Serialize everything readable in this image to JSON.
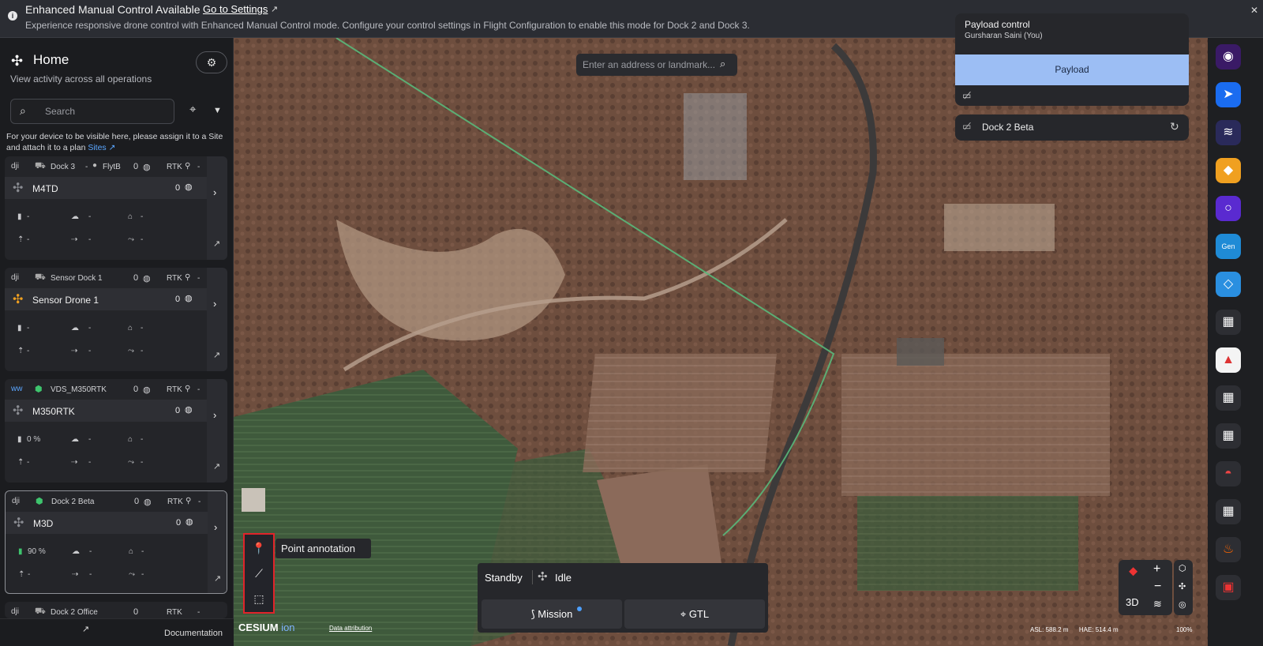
{
  "banner": {
    "title": "Enhanced Manual Control Available",
    "link": "Go to Settings",
    "body": "Experience responsive drone control with Enhanced Manual Control mode. Configure your control settings in Flight Configuration to enable this mode for Dock 2 and Dock 3."
  },
  "sidebar": {
    "title": "Home",
    "subtitle": "View activity across all operations",
    "search_placeholder": "Search",
    "note_text": "For your device to be visible here, please assign it to a Site and attach it to a plan",
    "note_link": "Sites"
  },
  "cards": [
    {
      "dock": "Dock 3",
      "dash": "-",
      "site": "FlytB",
      "count": "0",
      "rtk": "RTK",
      "rtk_val": "-",
      "drone": "M4TD",
      "drone_count": "0",
      "batt": "-",
      "wx": "-",
      "home": "-",
      "alt": "-",
      "speed": "-",
      "dist": "-"
    },
    {
      "dock": "Sensor Dock 1",
      "dash": "",
      "site": "",
      "count": "0",
      "rtk": "RTK",
      "rtk_val": "-",
      "drone": "Sensor Drone 1",
      "drone_count": "0",
      "batt": "-",
      "wx": "-",
      "home": "-",
      "alt": "-",
      "speed": "-",
      "dist": "-"
    },
    {
      "dock": "VDS_M350RTK",
      "dash": "",
      "site": "",
      "count": "0",
      "rtk": "RTK",
      "rtk_val": "-",
      "drone": "M350RTK",
      "drone_count": "0",
      "batt": "0 %",
      "wx": "-",
      "home": "-",
      "alt": "-",
      "speed": "-",
      "dist": "-"
    },
    {
      "dock": "Dock 2 Beta",
      "dash": "",
      "site": "",
      "count": "0",
      "rtk": "RTK",
      "rtk_val": "-",
      "drone": "M3D",
      "drone_count": "0",
      "batt": "90 %",
      "wx": "-",
      "home": "-",
      "alt": "-",
      "speed": "-",
      "dist": "-"
    },
    {
      "dock": "Dock 2 Office",
      "count": "0",
      "rtk": "RTK",
      "rtk_val": "-"
    }
  ],
  "footer": {
    "documentation": "Documentation"
  },
  "map": {
    "search_placeholder": "Enter an address or landmark...",
    "attribution": "Data attribution",
    "cesium": "CESIUM",
    "ion": "ion"
  },
  "payload_panel": {
    "title": "Payload control",
    "user": "Gursharan Saini (You)",
    "button": "Payload"
  },
  "dock_panel": {
    "name": "Dock 2 Beta"
  },
  "tools": {
    "tooltip": "Point annotation"
  },
  "status": {
    "state": "Standby",
    "drone_state": "Idle",
    "mission": "Mission",
    "gtl": "GTL"
  },
  "map_controls": {
    "mode": "3D"
  },
  "readout": {
    "asl_label": "ASL:",
    "asl": "588.2 m",
    "hae_label": "HAE:",
    "hae": "514.4 m",
    "zoom": "100%"
  },
  "colors": {
    "accent": "#9cbef4",
    "highlight": "#e0242a",
    "link": "#5aa6ff",
    "battery_ok": "#3ec46d"
  }
}
